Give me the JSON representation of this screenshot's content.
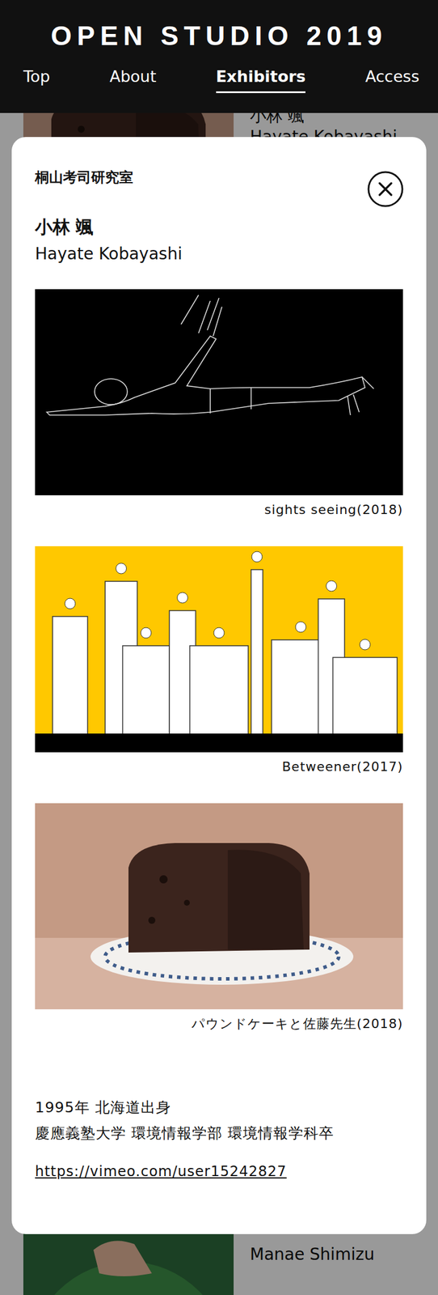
{
  "header": {
    "title": "OPEN STUDIO 2019"
  },
  "nav": [
    {
      "label": "Top",
      "selected": false
    },
    {
      "label": "About",
      "selected": false
    },
    {
      "label": "Exhibitors",
      "selected": true
    },
    {
      "label": "Access",
      "selected": false
    }
  ],
  "background_list": [
    {
      "kind": "cake",
      "lines": [
        "小林 颯",
        "Hayate Kobayashi"
      ]
    },
    {
      "kind": "green",
      "lines": [
        "Manae Shimizu"
      ]
    }
  ],
  "modal": {
    "lab": "桐山考司研究室",
    "name_ja": "小林 颯",
    "name_en": "Hayate Kobayashi",
    "works": [
      {
        "kind": "line-drawing",
        "caption": "sights seeing(2018)"
      },
      {
        "kind": "illustration",
        "caption": "Betweener(2017)"
      },
      {
        "kind": "photo",
        "caption": "パウンドケーキと佐藤先生(2018)"
      }
    ],
    "bio": [
      "1995年 北海道出身",
      "慶應義塾大学 環境情報学部 環境情報学科卒"
    ],
    "link": "https://vimeo.com/user15242827"
  }
}
